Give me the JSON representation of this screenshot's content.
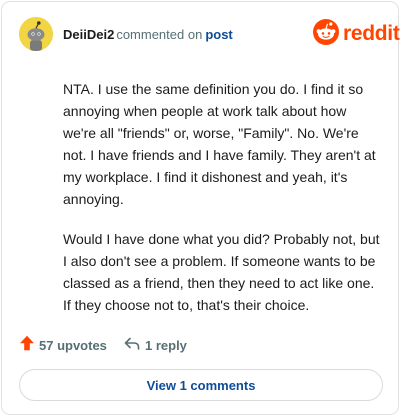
{
  "header": {
    "username": "DeiiDei2",
    "action_text": "commented on",
    "post_link": "post",
    "brand_name": "reddit",
    "brand_icon": "reddit-snoo-icon",
    "brand_color": "#ff4500",
    "avatar_icon": "snoo-avatar-icon",
    "avatar_color": "#f2d543"
  },
  "comment": {
    "paragraphs": [
      "NTA. I use the same definition you do. I find it so annoying when people at work talk about how we're all \"friends\" or, worse, \"Family\". No. We're not. I have friends and I have family. They aren't at my workplace. I find it dishonest and yeah, it's annoying.",
      "Would I have done what you did? Probably not, but I also don't see a problem. If someone wants to be classed as a friend, then they need to act like one. If they choose not to, that's their choice."
    ]
  },
  "footer": {
    "upvotes_label": "57 upvotes",
    "upvote_icon": "upvote-arrow-icon",
    "upvote_color": "#ff4500",
    "replies_label": "1 reply",
    "reply_icon": "reply-arrow-icon",
    "view_comments_label": "View 1 comments",
    "link_color": "#0f4c97"
  }
}
